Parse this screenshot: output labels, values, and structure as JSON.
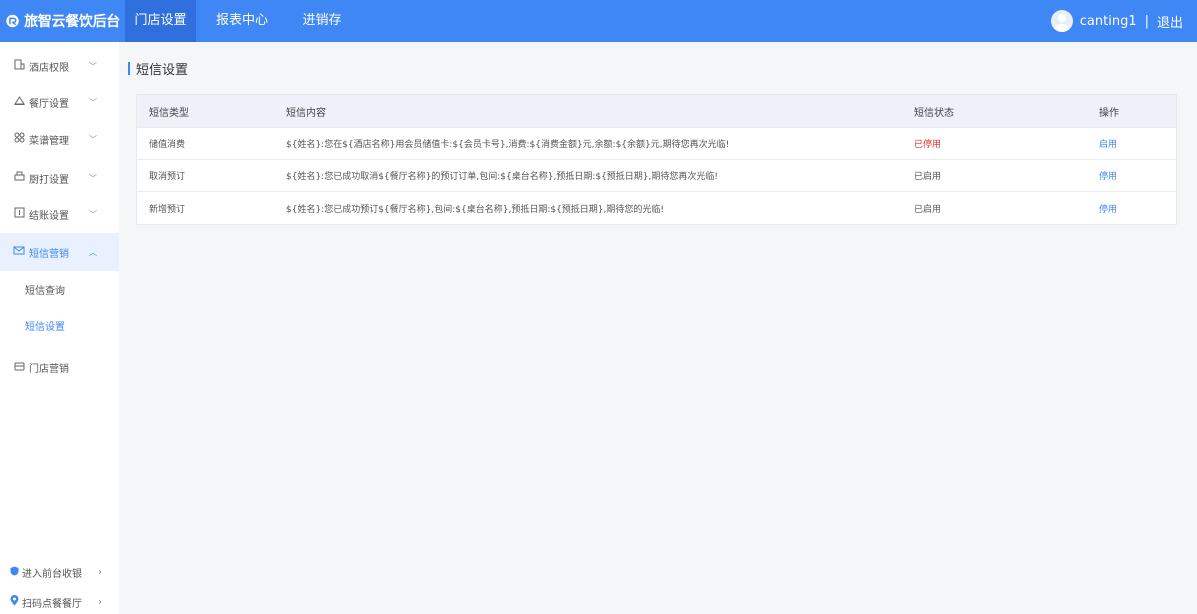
{
  "app": {
    "logo_text": "旅智云餐饮后台"
  },
  "nav": {
    "tabs": [
      {
        "label": "门店设置"
      },
      {
        "label": "报表中心"
      },
      {
        "label": "进销存"
      }
    ]
  },
  "user": {
    "name": "canting1",
    "separator": "|",
    "logout_label": "退出"
  },
  "sidebar": {
    "items": [
      {
        "label": "酒店权限",
        "icon": "building-icon"
      },
      {
        "label": "餐厅设置",
        "icon": "restaurant-icon"
      },
      {
        "label": "菜谱管理",
        "icon": "grid-icon"
      },
      {
        "label": "厨打设置",
        "icon": "printer-icon"
      },
      {
        "label": "结账设置",
        "icon": "checkout-icon"
      },
      {
        "label": "短信营销",
        "icon": "mail-icon"
      },
      {
        "label": "门店营销",
        "icon": "store-icon"
      }
    ],
    "submenu": [
      {
        "label": "短信查询"
      },
      {
        "label": "短信设置"
      }
    ],
    "bottom_links": [
      {
        "label": "进入前台收银",
        "icon": "shield-icon"
      },
      {
        "label": "扫码点餐餐厅",
        "icon": "location-pin-icon"
      }
    ]
  },
  "page": {
    "title": "短信设置"
  },
  "table": {
    "columns": [
      "短信类型",
      "短信内容",
      "短信状态",
      "操作"
    ],
    "rows": [
      {
        "type": "储值消费",
        "content": "${姓名}:您在${酒店名称}用会员储值卡:${会员卡号},消费:${消费金额}元,余额:${余额}元,期待您再次光临!",
        "status": "已停用",
        "action": "启用"
      },
      {
        "type": "取消预订",
        "content": "${姓名}:您已成功取消${餐厅名称}的预订订单,包间:${桌台名称},预抵日期:${预抵日期},期待您再次光临!",
        "status": "已启用",
        "action": "停用"
      },
      {
        "type": "新增预订",
        "content": "${姓名}:您已成功预订${餐厅名称},包间:${桌台名称},预抵日期:${预抵日期},期待您的光临!",
        "status": "已启用",
        "action": "停用"
      }
    ]
  },
  "colors": {
    "primary": "#3e87f4",
    "danger": "#e0322b"
  }
}
